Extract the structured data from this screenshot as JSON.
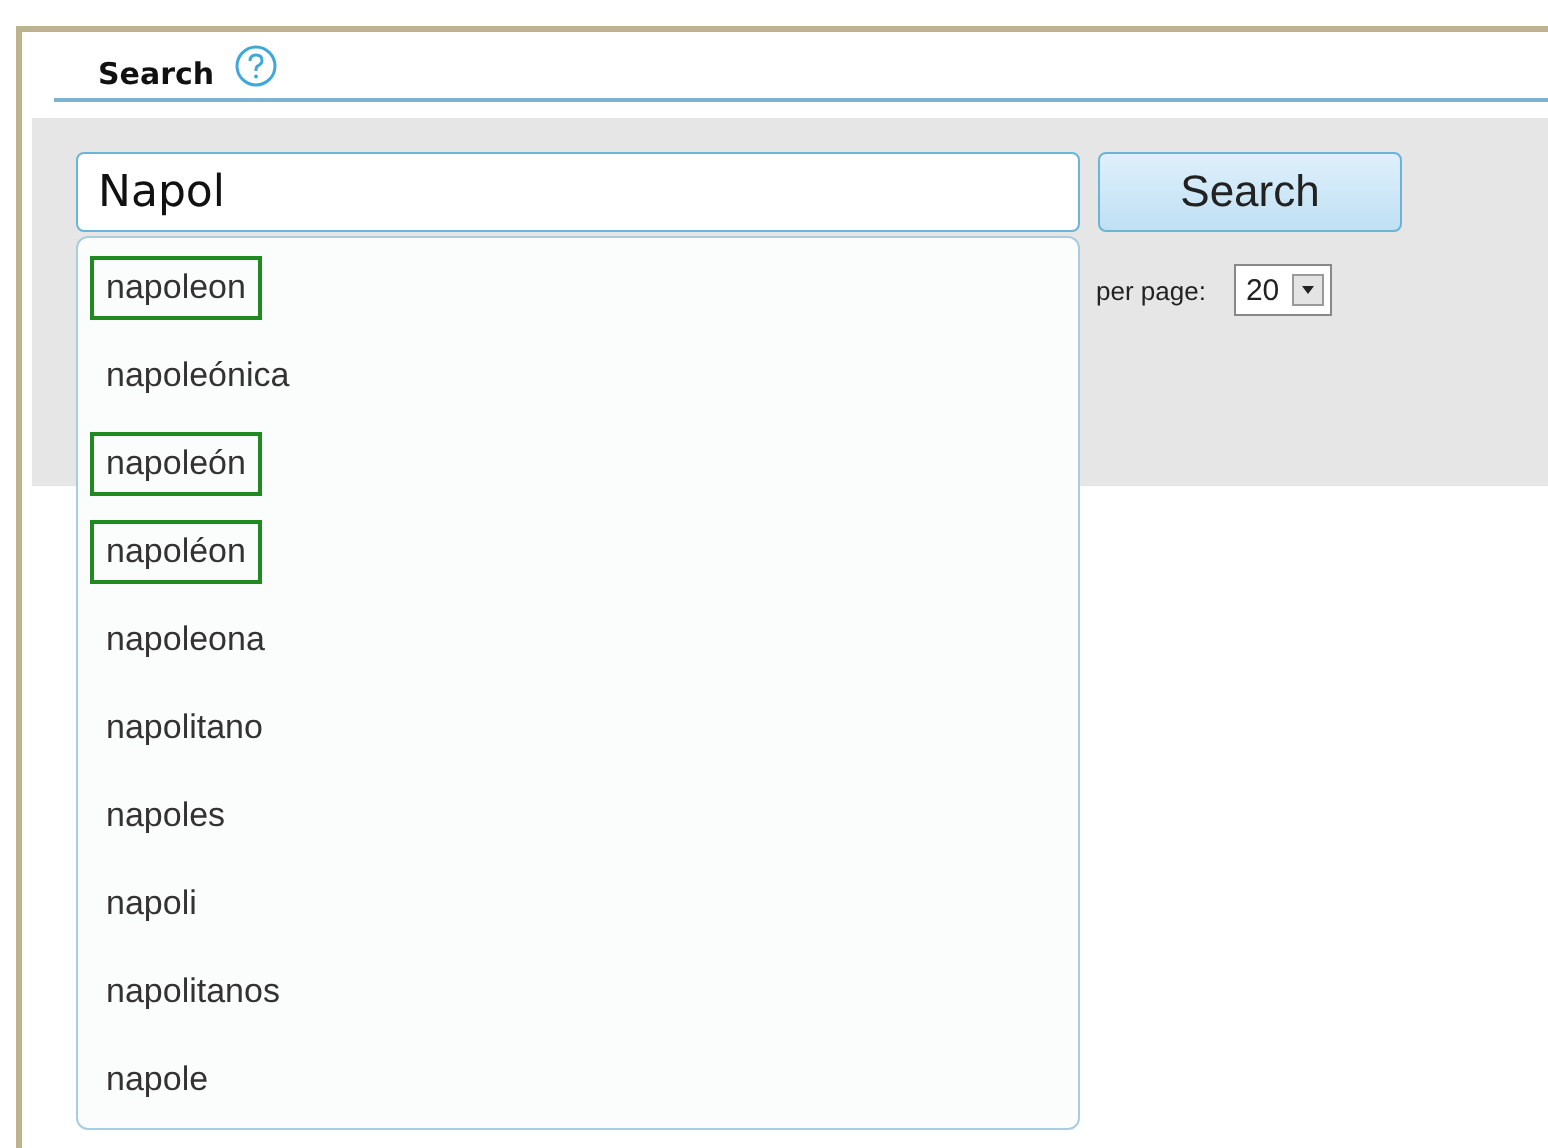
{
  "section": {
    "title": "Search"
  },
  "search": {
    "value": "Napol",
    "button": "Search"
  },
  "per_page": {
    "label": "per page:",
    "value": "20"
  },
  "suggestions": [
    {
      "text": "napoleon",
      "marked": true
    },
    {
      "text": "napoleónica",
      "marked": false
    },
    {
      "text": "napoleón",
      "marked": true
    },
    {
      "text": "napoléon",
      "marked": true
    },
    {
      "text": "napoleona",
      "marked": false
    },
    {
      "text": "napolitano",
      "marked": false
    },
    {
      "text": "napoles",
      "marked": false
    },
    {
      "text": "napoli",
      "marked": false
    },
    {
      "text": "napolitanos",
      "marked": false
    },
    {
      "text": "napole",
      "marked": false
    }
  ]
}
